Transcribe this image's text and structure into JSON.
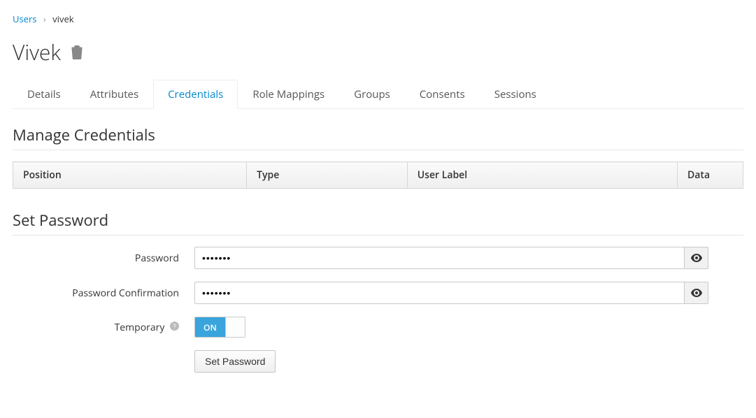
{
  "breadcrumb": {
    "parent": "Users",
    "current": "vivek"
  },
  "page_title": "Vivek",
  "tabs": [
    {
      "id": "details",
      "label": "Details",
      "active": false
    },
    {
      "id": "attributes",
      "label": "Attributes",
      "active": false
    },
    {
      "id": "credentials",
      "label": "Credentials",
      "active": true
    },
    {
      "id": "role-mappings",
      "label": "Role Mappings",
      "active": false
    },
    {
      "id": "groups",
      "label": "Groups",
      "active": false
    },
    {
      "id": "consents",
      "label": "Consents",
      "active": false
    },
    {
      "id": "sessions",
      "label": "Sessions",
      "active": false
    }
  ],
  "sections": {
    "manage_heading": "Manage Credentials",
    "set_password_heading": "Set Password"
  },
  "cred_table": {
    "headers": [
      "Position",
      "Type",
      "User Label",
      "Data"
    ]
  },
  "form": {
    "password_label": "Password",
    "password_value": "•••••••",
    "password_confirm_label": "Password Confirmation",
    "password_confirm_value": "•••••••",
    "temporary_label": "Temporary",
    "temporary_on": "ON",
    "submit_label": "Set Password"
  }
}
